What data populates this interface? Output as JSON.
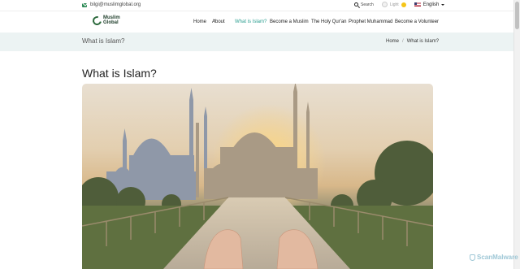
{
  "topbar": {
    "email": "bilgi@muslimglobal.org",
    "search_label": "Search",
    "theme_label": "Light",
    "language": "English"
  },
  "logo": {
    "line1": "Muslim",
    "line2": "Global"
  },
  "nav": {
    "items": [
      {
        "label": "Home"
      },
      {
        "label": "About"
      },
      {
        "label": "What is Islam?"
      },
      {
        "label": "Become a Muslim"
      },
      {
        "label": "The Holy Qur'an"
      },
      {
        "label": "Prophet Muhammad"
      },
      {
        "label": "Become a Volunteer"
      }
    ],
    "active": "What is Islam?"
  },
  "banner": {
    "title": "What is Islam?",
    "breadcrumb": [
      "Home",
      "/",
      "What is Islam?"
    ]
  },
  "page": {
    "heading": "What is Islam?"
  },
  "hero": {
    "icon": "mosque-sunset-image"
  },
  "watermark": "ScanMalware",
  "colors": {
    "accent": "#2a9d8f",
    "brand": "#2e6b3e",
    "banner_bg": "#ecf3f3"
  }
}
